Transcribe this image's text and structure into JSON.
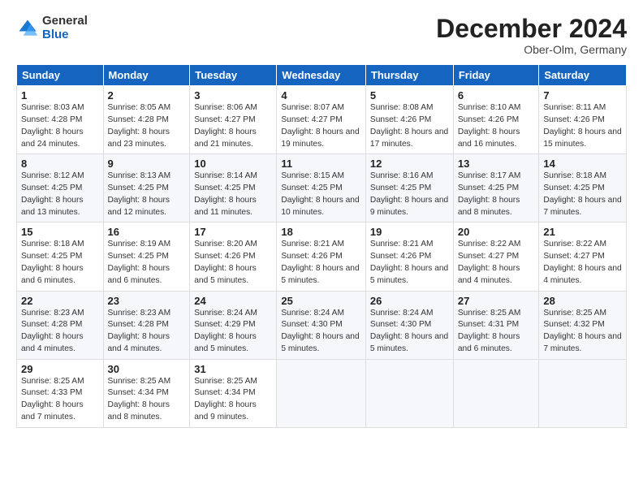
{
  "header": {
    "logo_general": "General",
    "logo_blue": "Blue",
    "month_title": "December 2024",
    "subtitle": "Ober-Olm, Germany"
  },
  "days_of_week": [
    "Sunday",
    "Monday",
    "Tuesday",
    "Wednesday",
    "Thursday",
    "Friday",
    "Saturday"
  ],
  "weeks": [
    [
      {
        "day": "1",
        "sunrise": "Sunrise: 8:03 AM",
        "sunset": "Sunset: 4:28 PM",
        "daylight": "Daylight: 8 hours and 24 minutes."
      },
      {
        "day": "2",
        "sunrise": "Sunrise: 8:05 AM",
        "sunset": "Sunset: 4:28 PM",
        "daylight": "Daylight: 8 hours and 23 minutes."
      },
      {
        "day": "3",
        "sunrise": "Sunrise: 8:06 AM",
        "sunset": "Sunset: 4:27 PM",
        "daylight": "Daylight: 8 hours and 21 minutes."
      },
      {
        "day": "4",
        "sunrise": "Sunrise: 8:07 AM",
        "sunset": "Sunset: 4:27 PM",
        "daylight": "Daylight: 8 hours and 19 minutes."
      },
      {
        "day": "5",
        "sunrise": "Sunrise: 8:08 AM",
        "sunset": "Sunset: 4:26 PM",
        "daylight": "Daylight: 8 hours and 17 minutes."
      },
      {
        "day": "6",
        "sunrise": "Sunrise: 8:10 AM",
        "sunset": "Sunset: 4:26 PM",
        "daylight": "Daylight: 8 hours and 16 minutes."
      },
      {
        "day": "7",
        "sunrise": "Sunrise: 8:11 AM",
        "sunset": "Sunset: 4:26 PM",
        "daylight": "Daylight: 8 hours and 15 minutes."
      }
    ],
    [
      {
        "day": "8",
        "sunrise": "Sunrise: 8:12 AM",
        "sunset": "Sunset: 4:25 PM",
        "daylight": "Daylight: 8 hours and 13 minutes."
      },
      {
        "day": "9",
        "sunrise": "Sunrise: 8:13 AM",
        "sunset": "Sunset: 4:25 PM",
        "daylight": "Daylight: 8 hours and 12 minutes."
      },
      {
        "day": "10",
        "sunrise": "Sunrise: 8:14 AM",
        "sunset": "Sunset: 4:25 PM",
        "daylight": "Daylight: 8 hours and 11 minutes."
      },
      {
        "day": "11",
        "sunrise": "Sunrise: 8:15 AM",
        "sunset": "Sunset: 4:25 PM",
        "daylight": "Daylight: 8 hours and 10 minutes."
      },
      {
        "day": "12",
        "sunrise": "Sunrise: 8:16 AM",
        "sunset": "Sunset: 4:25 PM",
        "daylight": "Daylight: 8 hours and 9 minutes."
      },
      {
        "day": "13",
        "sunrise": "Sunrise: 8:17 AM",
        "sunset": "Sunset: 4:25 PM",
        "daylight": "Daylight: 8 hours and 8 minutes."
      },
      {
        "day": "14",
        "sunrise": "Sunrise: 8:18 AM",
        "sunset": "Sunset: 4:25 PM",
        "daylight": "Daylight: 8 hours and 7 minutes."
      }
    ],
    [
      {
        "day": "15",
        "sunrise": "Sunrise: 8:18 AM",
        "sunset": "Sunset: 4:25 PM",
        "daylight": "Daylight: 8 hours and 6 minutes."
      },
      {
        "day": "16",
        "sunrise": "Sunrise: 8:19 AM",
        "sunset": "Sunset: 4:25 PM",
        "daylight": "Daylight: 8 hours and 6 minutes."
      },
      {
        "day": "17",
        "sunrise": "Sunrise: 8:20 AM",
        "sunset": "Sunset: 4:26 PM",
        "daylight": "Daylight: 8 hours and 5 minutes."
      },
      {
        "day": "18",
        "sunrise": "Sunrise: 8:21 AM",
        "sunset": "Sunset: 4:26 PM",
        "daylight": "Daylight: 8 hours and 5 minutes."
      },
      {
        "day": "19",
        "sunrise": "Sunrise: 8:21 AM",
        "sunset": "Sunset: 4:26 PM",
        "daylight": "Daylight: 8 hours and 5 minutes."
      },
      {
        "day": "20",
        "sunrise": "Sunrise: 8:22 AM",
        "sunset": "Sunset: 4:27 PM",
        "daylight": "Daylight: 8 hours and 4 minutes."
      },
      {
        "day": "21",
        "sunrise": "Sunrise: 8:22 AM",
        "sunset": "Sunset: 4:27 PM",
        "daylight": "Daylight: 8 hours and 4 minutes."
      }
    ],
    [
      {
        "day": "22",
        "sunrise": "Sunrise: 8:23 AM",
        "sunset": "Sunset: 4:28 PM",
        "daylight": "Daylight: 8 hours and 4 minutes."
      },
      {
        "day": "23",
        "sunrise": "Sunrise: 8:23 AM",
        "sunset": "Sunset: 4:28 PM",
        "daylight": "Daylight: 8 hours and 4 minutes."
      },
      {
        "day": "24",
        "sunrise": "Sunrise: 8:24 AM",
        "sunset": "Sunset: 4:29 PM",
        "daylight": "Daylight: 8 hours and 5 minutes."
      },
      {
        "day": "25",
        "sunrise": "Sunrise: 8:24 AM",
        "sunset": "Sunset: 4:30 PM",
        "daylight": "Daylight: 8 hours and 5 minutes."
      },
      {
        "day": "26",
        "sunrise": "Sunrise: 8:24 AM",
        "sunset": "Sunset: 4:30 PM",
        "daylight": "Daylight: 8 hours and 5 minutes."
      },
      {
        "day": "27",
        "sunrise": "Sunrise: 8:25 AM",
        "sunset": "Sunset: 4:31 PM",
        "daylight": "Daylight: 8 hours and 6 minutes."
      },
      {
        "day": "28",
        "sunrise": "Sunrise: 8:25 AM",
        "sunset": "Sunset: 4:32 PM",
        "daylight": "Daylight: 8 hours and 7 minutes."
      }
    ],
    [
      {
        "day": "29",
        "sunrise": "Sunrise: 8:25 AM",
        "sunset": "Sunset: 4:33 PM",
        "daylight": "Daylight: 8 hours and 7 minutes."
      },
      {
        "day": "30",
        "sunrise": "Sunrise: 8:25 AM",
        "sunset": "Sunset: 4:34 PM",
        "daylight": "Daylight: 8 hours and 8 minutes."
      },
      {
        "day": "31",
        "sunrise": "Sunrise: 8:25 AM",
        "sunset": "Sunset: 4:34 PM",
        "daylight": "Daylight: 8 hours and 9 minutes."
      },
      null,
      null,
      null,
      null
    ]
  ]
}
